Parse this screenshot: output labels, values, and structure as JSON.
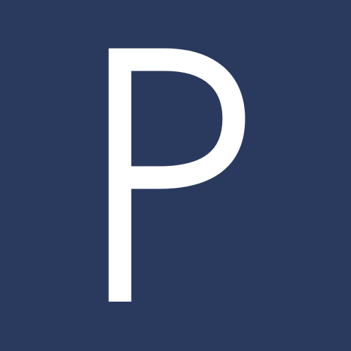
{
  "app_icon": {
    "letter": "P",
    "background_color": "#2a3a5f",
    "letter_color": "#ffffff"
  }
}
